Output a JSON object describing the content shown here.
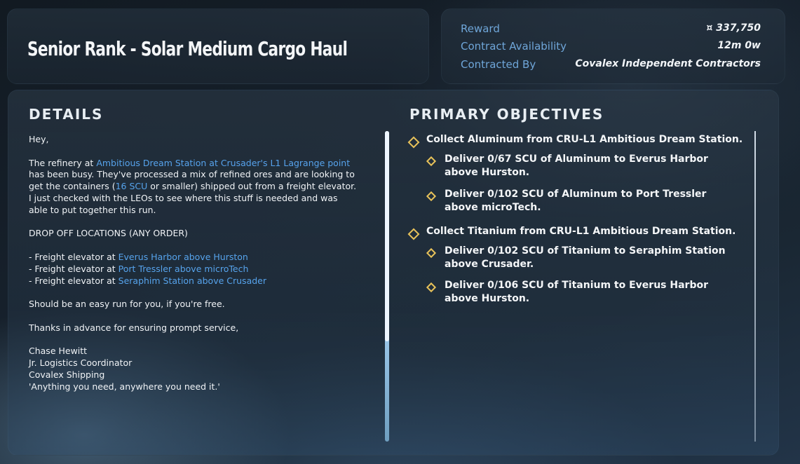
{
  "title": "Senior Rank - Solar Medium Cargo Haul",
  "meta": {
    "reward_label": "Reward",
    "reward_value": "¤ 337,750",
    "availability_label": "Contract Availability",
    "availability_value": "12m 0w",
    "contracted_by_label": "Contracted By",
    "contracted_by_value": "Covalex Independent Contractors"
  },
  "details": {
    "heading": "DETAILS",
    "greeting": "Hey,",
    "p1_a": "The refinery at ",
    "p1_link": "Ambitious Dream Station at Crusader's L1 Lagrange point",
    "p1_b": " has been busy. They've processed a mix of refined ores and are looking to get the containers (",
    "p1_scu": "16 SCU",
    "p1_c": " or smaller) shipped out from a freight elevator. I just checked with the LEOs to see where this stuff is needed and was able to put together this run.",
    "dropoff_heading": "DROP OFF LOCATIONS (ANY ORDER)",
    "drop_prefix": "- Freight elevator at ",
    "drop1": "Everus Harbor above Hurston",
    "drop2": "Port Tressler above microTech",
    "drop3": "Seraphim Station above Crusader",
    "easy": "Should be an easy run for you, if you're free.",
    "thanks": "Thanks in advance for ensuring prompt service,",
    "sig_name": "Chase Hewitt",
    "sig_title": "Jr. Logistics Coordinator",
    "sig_company": "Covalex Shipping",
    "sig_motto": "'Anything you need, anywhere you need it.'"
  },
  "objectives": {
    "heading": "PRIMARY OBJECTIVES",
    "o1": "Collect Aluminum from CRU-L1 Ambitious Dream Station.",
    "o1a": "Deliver 0/67 SCU of Aluminum to Everus Harbor above Hurston.",
    "o1b": "Deliver 0/102 SCU of Aluminum to Port Tressler above microTech.",
    "o2": "Collect Titanium from CRU-L1 Ambitious Dream Station.",
    "o2a": "Deliver 0/102 SCU of Titanium to Seraphim Station above Crusader.",
    "o2b": "Deliver 0/106 SCU of Titanium to Everus Harbor above Hurston."
  },
  "colors": {
    "accent": "#6fa6d9",
    "link": "#56a3ec",
    "diamond": "#e8c25a"
  }
}
